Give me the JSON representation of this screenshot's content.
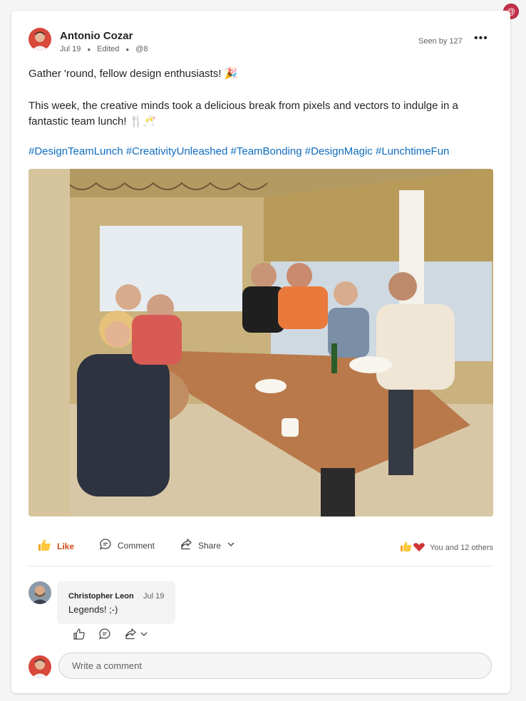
{
  "app": {
    "notification_badge": "@"
  },
  "post": {
    "author": "Antonio Cozar",
    "date": "Jul 19",
    "edited": "Edited",
    "mention": "@8",
    "seen_by": "Seen by 127",
    "line1": "Gather 'round, fellow design enthusiasts! 🎉",
    "line2": "This week, the creative minds took a delicious break from pixels and vectors to indulge in a fantastic team lunch! 🍴🥂",
    "hashtags": [
      "#DesignTeamLunch",
      "#CreativityUnleashed",
      "#TeamBonding",
      "#DesignMagic",
      "#LunchtimeFun"
    ]
  },
  "actions": {
    "like_label": "Like",
    "comment_label": "Comment",
    "share_label": "Share",
    "reactions_text": "You and 12 others"
  },
  "comment": {
    "author": "Christopher Leon",
    "date": "Jul 19",
    "text": "Legends! ;-)"
  },
  "composer": {
    "placeholder": "Write a comment"
  },
  "colors": {
    "accent": "#0f6cbd",
    "like": "#cc4a1a",
    "heart": "#d13438",
    "badge": "#c4314b"
  }
}
